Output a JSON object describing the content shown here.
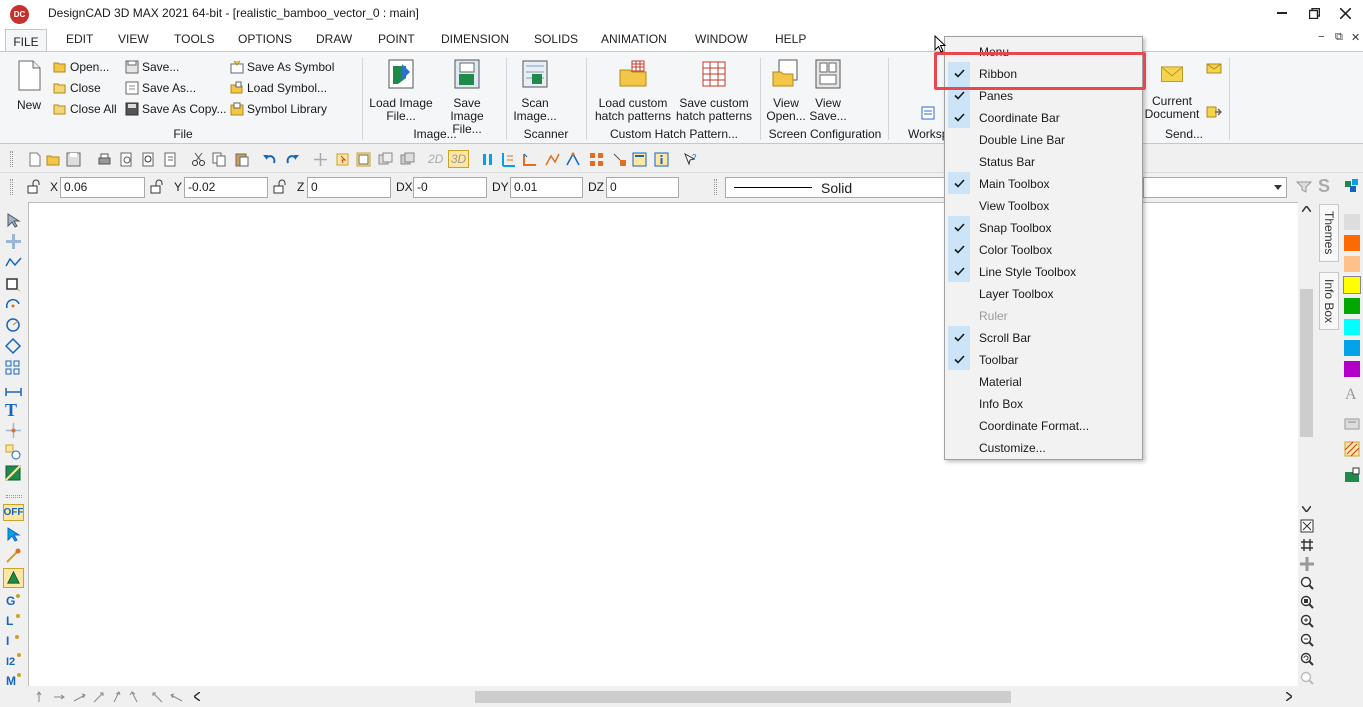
{
  "window": {
    "title": "DesignCAD 3D MAX 2021 64-bit - [realistic_bamboo_vector_0 : main]",
    "logo_text": "DC",
    "controls": [
      "minimize",
      "restore",
      "close"
    ],
    "mdi_controls": [
      "−",
      "⧉",
      "✕"
    ]
  },
  "menu": [
    "FILE",
    "EDIT",
    "VIEW",
    "TOOLS",
    "OPTIONS",
    "DRAW",
    "POINT",
    "DIMENSION",
    "SOLIDS",
    "ANIMATION",
    "WINDOW",
    "HELP"
  ],
  "ribbon": {
    "file": {
      "new": "New",
      "open": "Open...",
      "close": "Close",
      "close_all": "Close All",
      "save": "Save...",
      "save_as": "Save As...",
      "save_as_copy": "Save As Copy...",
      "save_as_symbol": "Save As Symbol",
      "load_symbol": "Load Symbol...",
      "symbol_library": "Symbol Library",
      "group": "File"
    },
    "image": {
      "load_l1": "Load Image",
      "load_l2": "File...",
      "save_l1": "Save Image",
      "save_l2": "File...",
      "group": "Image..."
    },
    "scanner": {
      "scan_l1": "Scan",
      "scan_l2": "Image...",
      "group": "Scanner"
    },
    "hatch": {
      "load_l1": "Load custom",
      "load_l2": "hatch patterns",
      "save_l1": "Save custom",
      "save_l2": "hatch patterns",
      "group": "Custom Hatch Pattern..."
    },
    "screen": {
      "view_open_l1": "View",
      "view_open_l2": "Open...",
      "view_save_l1": "View",
      "view_save_l2": "Save...",
      "group": "Screen Configuration"
    },
    "workspace": {
      "label": "Worksp"
    },
    "send": {
      "current_l1": "Current",
      "current_l2": "Document",
      "group": "Send..."
    }
  },
  "toolbar": {
    "mode_2d": "2D",
    "mode_3d": "3D"
  },
  "coords": {
    "x_label": "X",
    "x_value": "0.06",
    "y_label": "Y",
    "y_value": "-0.02",
    "z_label": "Z",
    "z_value": "0",
    "dx_label": "DX",
    "dx_value": "-0",
    "dy_label": "DY",
    "dy_value": "0.01",
    "dz_label": "DZ",
    "dz_value": "0",
    "line_style": "Solid"
  },
  "left_toolbox": {
    "snap_off": "OFF"
  },
  "side_tabs": {
    "themes": "Themes",
    "info_box": "Info Box"
  },
  "colors": {
    "swatches": [
      "#dddddd",
      "#ff6a00",
      "#ffc08a",
      "#ffff00",
      "#00a800",
      "#00ffff",
      "#00a2e8",
      "#b200c8"
    ],
    "accent": "#0078d7",
    "highlight": "#e8484d"
  },
  "context_menu": {
    "items": [
      {
        "label": "Menu",
        "checked": false,
        "disabled": false
      },
      {
        "label": "Ribbon",
        "checked": true,
        "disabled": false
      },
      {
        "label": "Panes",
        "checked": true,
        "disabled": false
      },
      {
        "label": "Coordinate Bar",
        "checked": true,
        "disabled": false
      },
      {
        "label": "Double Line Bar",
        "checked": false,
        "disabled": false
      },
      {
        "label": "Status Bar",
        "checked": false,
        "disabled": false
      },
      {
        "label": "Main Toolbox",
        "checked": true,
        "disabled": false
      },
      {
        "label": "View Toolbox",
        "checked": false,
        "disabled": false
      },
      {
        "label": "Snap Toolbox",
        "checked": true,
        "disabled": false
      },
      {
        "label": "Color Toolbox",
        "checked": true,
        "disabled": false
      },
      {
        "label": "Line Style Toolbox",
        "checked": true,
        "disabled": false
      },
      {
        "label": "Layer Toolbox",
        "checked": false,
        "disabled": false
      },
      {
        "label": "Ruler",
        "checked": false,
        "disabled": true
      },
      {
        "label": "Scroll Bar",
        "checked": true,
        "disabled": false
      },
      {
        "label": "Toolbar",
        "checked": true,
        "disabled": false
      },
      {
        "label": "Material",
        "checked": false,
        "disabled": false
      },
      {
        "label": "Info Box",
        "checked": false,
        "disabled": false
      },
      {
        "label": "Coordinate Format...",
        "checked": false,
        "disabled": false
      },
      {
        "label": "Customize...",
        "checked": false,
        "disabled": false
      }
    ]
  }
}
